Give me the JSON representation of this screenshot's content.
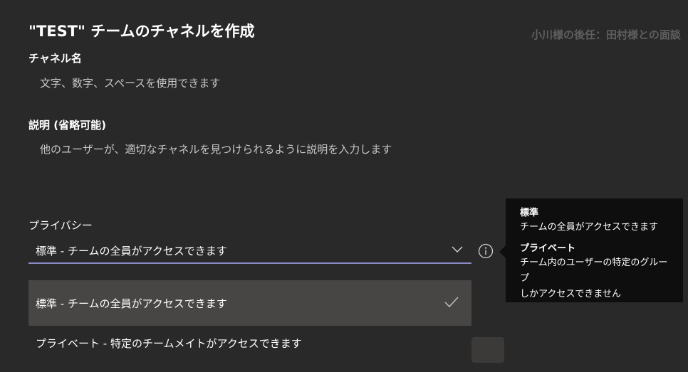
{
  "dialog": {
    "title": "\"TEST\" チームのチャネルを作成"
  },
  "background": {
    "meeting_text": "小川様の後任：田村様との面談"
  },
  "channel_name": {
    "label": "チャネル名",
    "placeholder": "文字、数字、スペースを使用できます",
    "value": ""
  },
  "description": {
    "label": "説明 (省略可能)",
    "placeholder": "他のユーザーが、適切なチャネルを見つけられるように説明を入力します",
    "value": ""
  },
  "privacy": {
    "label": "プライバシー",
    "selected_value": "標準 - チームの全員がアクセスできます",
    "options": [
      {
        "label": "標準 - チームの全員がアクセスできます",
        "selected": true
      },
      {
        "label": "プライベート - 特定のチームメイトがアクセスできます",
        "selected": false
      }
    ]
  },
  "tooltip": {
    "standard_heading": "標準",
    "standard_body": "チームの全員がアクセスできます",
    "private_heading": "プライベート",
    "private_body_line1": "チーム内のユーザーの特定のグループ",
    "private_body_line2": "しかアクセスできません"
  },
  "colors": {
    "background": "#292929",
    "accent_underline": "#8b8cc7",
    "selected_option": "#474645",
    "tooltip_bg": "#0e0e0e"
  },
  "icons": {
    "dropdown": "chevron-down-icon",
    "info": "info-icon",
    "selected": "checkmark-icon"
  }
}
